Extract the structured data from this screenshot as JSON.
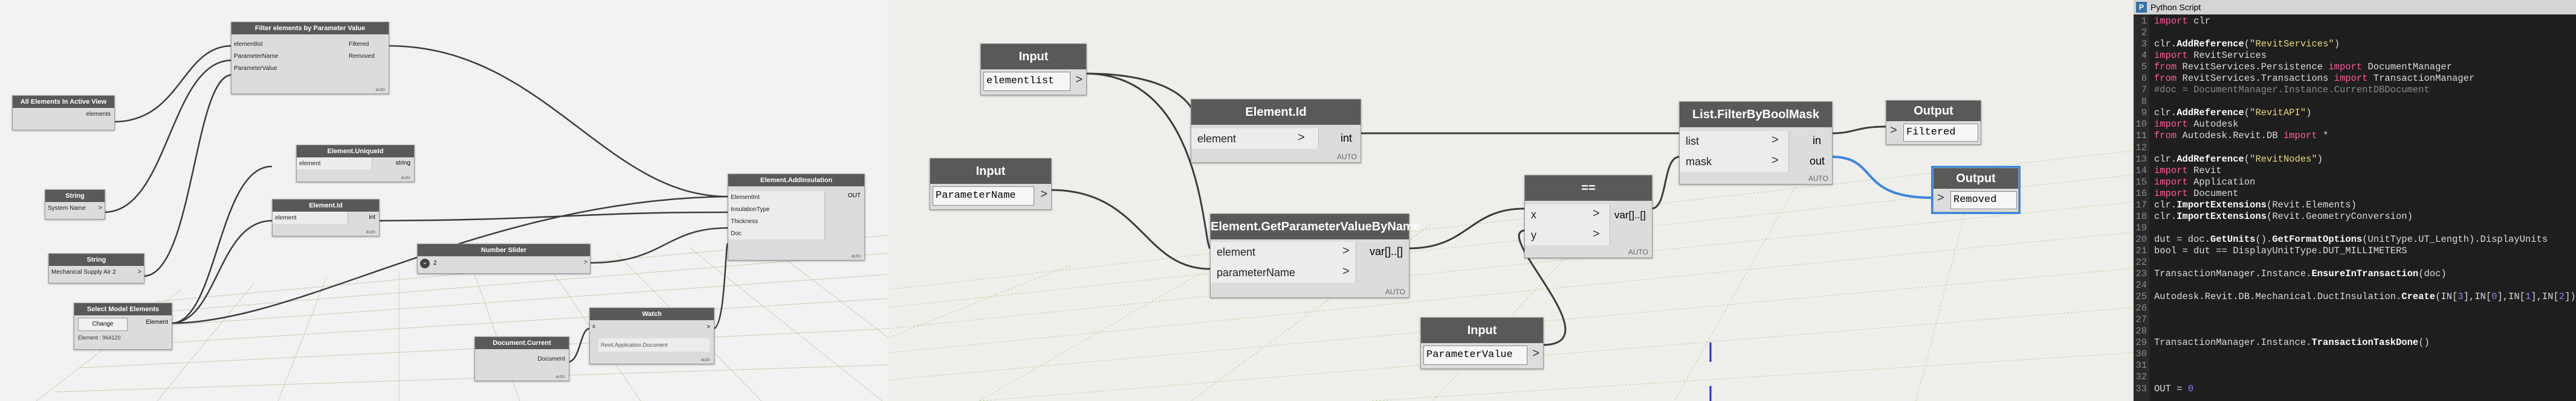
{
  "left_graph": {
    "nodes": {
      "filter_by_param": {
        "title": "Filter elements by Parameter Value",
        "inputs": [
          "elementlist",
          "ParameterName",
          "ParameterValue"
        ],
        "outputs": [
          "Filtered",
          "Removed"
        ],
        "footer": "auto"
      },
      "all_elements": {
        "title": "All Elements In Active View",
        "output": "elements"
      },
      "string1": {
        "title": "String",
        "value": "System Name",
        "arrow": ">"
      },
      "string2": {
        "title": "String",
        "value": "Mechanical Supply Air 2",
        "arrow": ">"
      },
      "select_model": {
        "title": "Select Model Elements",
        "button": "Change",
        "output": "Element",
        "status": "Element : 964120"
      },
      "uniqueid": {
        "title": "Element.UniqueId",
        "input": "element",
        "output": "string",
        "footer": "auto"
      },
      "element_id": {
        "title": "Element.Id",
        "input": "element",
        "output": "int",
        "footer": "auto"
      },
      "number_slider": {
        "title": "Number Slider",
        "value": "2",
        "toggle": "⌄",
        "arrow": ">"
      },
      "add_insulation": {
        "title": "Element.AddInsulation",
        "inputs": [
          "ElementInt",
          "InsulationType",
          "Thickness",
          "Doc"
        ],
        "output": "OUT",
        "footer": "auto"
      },
      "doc_current": {
        "title": "Document.Current",
        "output": "Document",
        "footer": "auto"
      },
      "watch": {
        "title": "Watch",
        "input": "x",
        "output": ">",
        "value": "Revit.Application.Document",
        "footer": "auto"
      }
    }
  },
  "mid_graph": {
    "nodes": {
      "input1": {
        "title": "Input",
        "value": "elementlist",
        "arrow": ">"
      },
      "input2": {
        "title": "Input",
        "value": "ParameterName",
        "arrow": ">"
      },
      "input3": {
        "title": "Input",
        "value": "ParameterValue",
        "arrow": ">"
      },
      "element_id": {
        "title": "Element.Id",
        "input": "element",
        "output": "int",
        "footer": "AUTO"
      },
      "get_param": {
        "title": "Element.GetParameterValueByName",
        "inputs": [
          "element",
          "parameterName"
        ],
        "output": "var[]..[]",
        "footer": "AUTO"
      },
      "equals": {
        "title": "==",
        "inputs": [
          "x",
          "y"
        ],
        "output": "var[]..[]",
        "footer": "AUTO"
      },
      "filter_mask": {
        "title": "List.FilterByBoolMask",
        "inputs": [
          "list",
          "mask"
        ],
        "outputs": [
          "in",
          "out"
        ],
        "footer": "AUTO"
      },
      "output1": {
        "title": "Output",
        "value": "Filtered",
        "arrow": ">"
      },
      "output2": {
        "title": "Output",
        "value": "Removed",
        "arrow": ">"
      }
    }
  },
  "code_editor": {
    "title": "Python Script",
    "icon": "python-icon",
    "lines": [
      [
        {
          "t": "import",
          "c": "kw"
        },
        {
          "t": " clr",
          "c": ""
        }
      ],
      [],
      [
        {
          "t": "clr.",
          "c": ""
        },
        {
          "t": "AddReference",
          "c": "fn"
        },
        {
          "t": "(",
          "c": ""
        },
        {
          "t": "\"RevitServices\"",
          "c": "str"
        },
        {
          "t": ")",
          "c": ""
        }
      ],
      [
        {
          "t": "import",
          "c": "kw"
        },
        {
          "t": " RevitServices",
          "c": ""
        }
      ],
      [
        {
          "t": "from",
          "c": "kw"
        },
        {
          "t": " RevitServices.Persistence ",
          "c": ""
        },
        {
          "t": "import",
          "c": "kw"
        },
        {
          "t": " DocumentManager",
          "c": ""
        }
      ],
      [
        {
          "t": "from",
          "c": "kw"
        },
        {
          "t": " RevitServices.Transactions ",
          "c": ""
        },
        {
          "t": "import",
          "c": "kw"
        },
        {
          "t": " TransactionManager",
          "c": ""
        }
      ],
      [
        {
          "t": "#doc = DocumentManager.Instance.CurrentDBDocument",
          "c": "cm"
        }
      ],
      [],
      [
        {
          "t": "clr.",
          "c": ""
        },
        {
          "t": "AddReference",
          "c": "fn"
        },
        {
          "t": "(",
          "c": ""
        },
        {
          "t": "\"RevitAPI\"",
          "c": "str"
        },
        {
          "t": ")",
          "c": ""
        }
      ],
      [
        {
          "t": "import",
          "c": "kw"
        },
        {
          "t": " Autodesk",
          "c": ""
        }
      ],
      [
        {
          "t": "from",
          "c": "kw"
        },
        {
          "t": " Autodesk.Revit.DB ",
          "c": ""
        },
        {
          "t": "import",
          "c": "kw"
        },
        {
          "t": " *",
          "c": ""
        }
      ],
      [],
      [
        {
          "t": "clr.",
          "c": ""
        },
        {
          "t": "AddReference",
          "c": "fn"
        },
        {
          "t": "(",
          "c": ""
        },
        {
          "t": "\"RevitNodes\"",
          "c": "str"
        },
        {
          "t": ")",
          "c": ""
        }
      ],
      [
        {
          "t": "import",
          "c": "kw"
        },
        {
          "t": " Revit",
          "c": ""
        }
      ],
      [
        {
          "t": "import",
          "c": "kw"
        },
        {
          "t": " Application",
          "c": ""
        }
      ],
      [
        {
          "t": "import",
          "c": "kw"
        },
        {
          "t": " Document",
          "c": ""
        }
      ],
      [
        {
          "t": "clr.",
          "c": ""
        },
        {
          "t": "ImportExtensions",
          "c": "fn"
        },
        {
          "t": "(Revit.Elements)",
          "c": ""
        }
      ],
      [
        {
          "t": "clr.",
          "c": ""
        },
        {
          "t": "ImportExtensions",
          "c": "fn"
        },
        {
          "t": "(Revit.GeometryConversion)",
          "c": ""
        }
      ],
      [],
      [
        {
          "t": "dut = doc.",
          "c": ""
        },
        {
          "t": "GetUnits",
          "c": "fn"
        },
        {
          "t": "().",
          "c": ""
        },
        {
          "t": "GetFormatOptions",
          "c": "fn"
        },
        {
          "t": "(UnitType.UT_Length).DisplayUnits",
          "c": ""
        }
      ],
      [
        {
          "t": "bool = dut == DisplayUnitType.DUT_MILLIMETERS",
          "c": ""
        }
      ],
      [],
      [
        {
          "t": "TransactionManager.Instance.",
          "c": ""
        },
        {
          "t": "EnsureInTransaction",
          "c": "fn"
        },
        {
          "t": "(doc)",
          "c": ""
        }
      ],
      [],
      [
        {
          "t": "Autodesk.Revit.DB.Mechanical.DuctInsulation.",
          "c": ""
        },
        {
          "t": "Create",
          "c": "fn"
        },
        {
          "t": "(IN[",
          "c": ""
        },
        {
          "t": "3",
          "c": "num"
        },
        {
          "t": "],IN[",
          "c": ""
        },
        {
          "t": "0",
          "c": "num"
        },
        {
          "t": "],IN[",
          "c": ""
        },
        {
          "t": "1",
          "c": "num"
        },
        {
          "t": "],IN[",
          "c": ""
        },
        {
          "t": "2",
          "c": "num"
        },
        {
          "t": "])",
          "c": ""
        }
      ],
      [],
      [],
      [],
      [
        {
          "t": "TransactionManager.Instance.",
          "c": ""
        },
        {
          "t": "TransactionTaskDone",
          "c": "fn"
        },
        {
          "t": "()",
          "c": ""
        }
      ],
      [],
      [],
      [],
      [
        {
          "t": "OUT = ",
          "c": ""
        },
        {
          "t": "0",
          "c": "num"
        }
      ]
    ]
  },
  "colors": {
    "wire": "#3c3c3c",
    "selected_wire": "#3a87e0",
    "node_header": "#595959",
    "node_body": "#dcdcdc",
    "grid_line": "#b5d59a",
    "code_bg": "#1e1e1e"
  }
}
